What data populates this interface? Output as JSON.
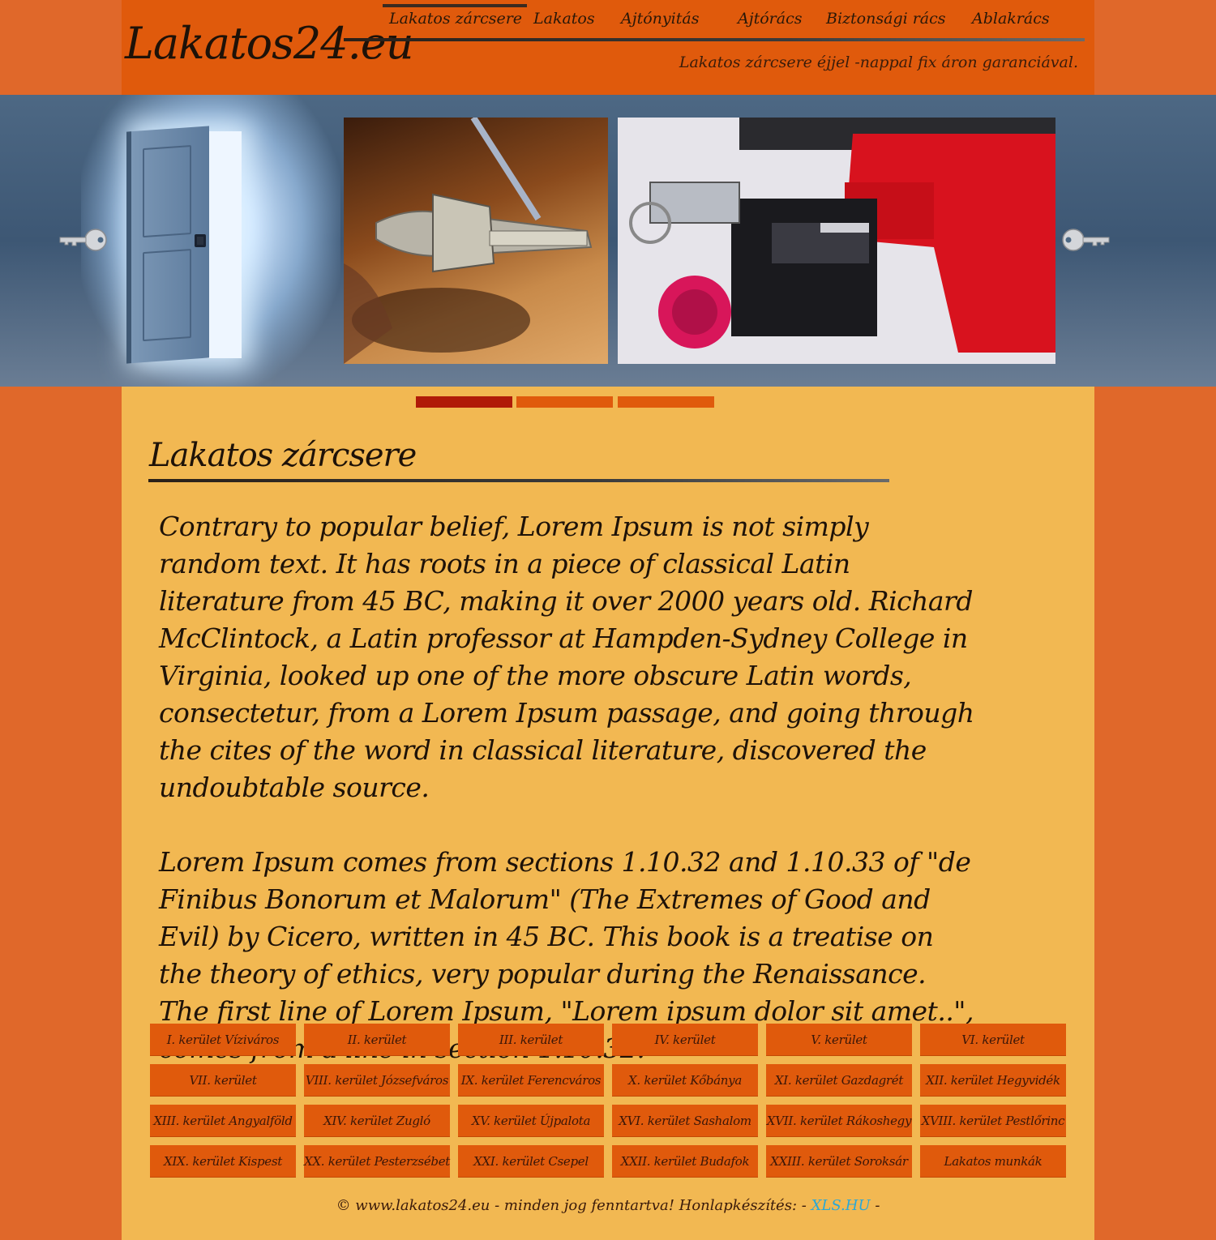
{
  "header": {
    "logo": "Lakatos24.eu",
    "tagline": "Lakatos zárcsere éjjel -nappal fix áron garanciával.",
    "nav": [
      {
        "label": "Lakatos zárcsere",
        "active": true
      },
      {
        "label": "Lakatos",
        "active": false
      },
      {
        "label": "Ajtónyitás",
        "active": false
      },
      {
        "label": "Ajtórács",
        "active": false
      },
      {
        "label": "Biztonsági rács",
        "active": false
      },
      {
        "label": "Ablakrács",
        "active": false
      }
    ]
  },
  "banner": {
    "prev_icon": "key-left-icon",
    "next_icon": "key-right-icon",
    "slide_count": 3,
    "active_slide": 1
  },
  "main": {
    "title": "Lakatos zárcsere",
    "paragraphs": [
      "Contrary to popular belief, Lorem Ipsum is not simply random text. It has roots in a piece of classical Latin literature from 45 BC, making it over 2000 years old. Richard McClintock, a Latin professor at Hampden-Sydney College in Virginia, looked up one of the more obscure Latin words, consectetur, from a Lorem Ipsum passage, and going through the cites of the word in classical literature, discovered the undoubtable source.",
      "Lorem Ipsum comes from sections 1.10.32 and 1.10.33 of \"de Finibus Bonorum et Malorum\" (The Extremes of Good and Evil) by Cicero, written in 45 BC. This book is a treatise on the theory of ethics, very popular during the Renaissance. The first line of Lorem Ipsum, \"Lorem ipsum dolor sit amet..\", comes from a line in section 1.10.32."
    ]
  },
  "districts": [
    "I. kerület Víziváros",
    "II. kerület",
    "III. kerület",
    "IV. kerület",
    "V. kerület",
    "VI. kerület",
    "VII. kerület",
    "VIII. kerület Józsefváros",
    "IX. kerület Ferencváros",
    "X. kerület Kőbánya",
    "XI. kerület Gazdagrét",
    "XII. kerület Hegyvidék",
    "XIII. kerület Angyalföld",
    "XIV. kerület Zugló",
    "XV. kerület Újpalota",
    "XVI. kerület Sashalom",
    "XVII. kerület Rákoshegy",
    "XVIII. kerület Pestlőrinc",
    "XIX. kerület Kispest",
    "XX. kerület Pesterzsébet",
    "XXI. kerület Csepel",
    "XXII. kerület Budafok",
    "XXIII. kerület Soroksár",
    "Lakatos munkák"
  ],
  "footer": {
    "text": "© www.lakatos24.eu - minden jog fenntartva!  Honlapkészítés: -",
    "link": "XLS.HU",
    "suffix": "-"
  },
  "colors": {
    "page_bg": "#e0682a",
    "header_bg": "#e05a0c",
    "content_bg": "#f2b852",
    "banner_bg": "#4d6884",
    "active_dot": "#b01a08",
    "link": "#2aa8d8"
  }
}
